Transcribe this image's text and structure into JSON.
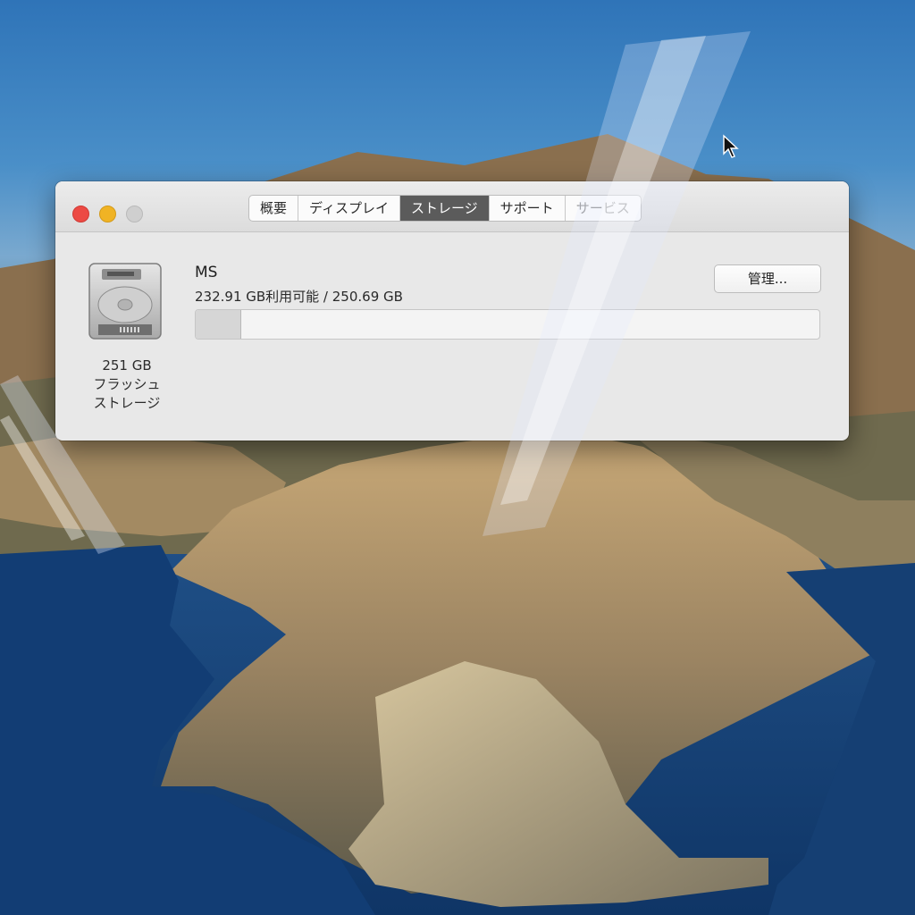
{
  "window": {
    "tabs": [
      "概要",
      "ディスプレイ",
      "ストレージ",
      "サポート",
      "サービス"
    ],
    "active_tab": "ストレージ"
  },
  "storage": {
    "volume_name": "MS",
    "usage_text": "232.91 GB利用可能 / 250.69 GB",
    "used_fraction": 0.071,
    "manage_label": "管理...",
    "drive": {
      "size_label": "251 GB",
      "type_line1": "フラッシュ",
      "type_line2": "ストレージ"
    }
  },
  "icons": {
    "drive": "flash-storage-drive-icon",
    "cursor": "mouse-pointer-icon"
  },
  "colors": {
    "close": "#ec4a44",
    "minimize": "#f0b324",
    "active_tab": "#5b5b5b"
  }
}
